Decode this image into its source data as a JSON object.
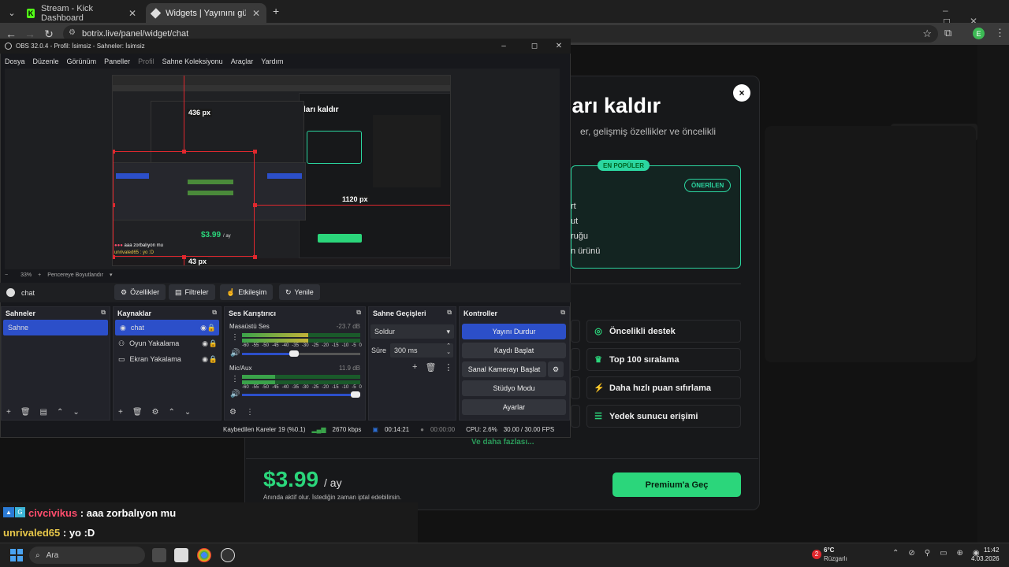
{
  "browser": {
    "tabs": [
      {
        "title": "Stream - Kick Dashboard",
        "active": false,
        "icon": "kick-logo"
      },
      {
        "title": "Widgets | Yayınını güçlendirmek",
        "active": true,
        "icon": "botrix-logo"
      }
    ],
    "new_tab": "+",
    "url": "botrix.live/panel/widget/chat",
    "profile_initial": "E"
  },
  "modal": {
    "title_fragment": "ları kaldır",
    "subtitle_fragment": "er, gelişmiş özellikler ve öncelikli",
    "badge_popular": "EN POPÜLER",
    "badge_recommended": "ÖNERİLEN",
    "plan_fragments": [
      "rt",
      "ut",
      "ruğu",
      "n ürünü"
    ],
    "features": [
      {
        "label": "Öncelikli destek",
        "icon": "headset-icon"
      },
      {
        "label": "Top 100 sıralama",
        "icon": "trophy-icon"
      },
      {
        "label": "Daha hızlı puan sıfırlama",
        "icon": "lightning-icon"
      },
      {
        "label": "Yedek sunucu erişimi",
        "icon": "server-icon"
      }
    ],
    "more": "Ve daha fazlası...",
    "price": "$3.99",
    "per": "/ ay",
    "note": "Anında aktif olur. İstediğin zaman iptal edebilirsin.",
    "cta": "Premium'a Geç",
    "close": "×"
  },
  "chat_overlay": [
    {
      "user": "civcivikus",
      "message": " : aaa zorbalıyon mu",
      "color": "#ff4d6d"
    },
    {
      "user": "unrivaled65",
      "message": " : yo :D",
      "color": "#e8c84a"
    }
  ],
  "obs": {
    "title": "OBS 32.0.4 - Profil: İsimsiz - Sahneler: İsimsiz",
    "menu": [
      "Dosya",
      "Düzenle",
      "Görünüm",
      "Paneller",
      "Profil",
      "Sahne Koleksiyonu",
      "Araçlar",
      "Yardım"
    ],
    "preview_labels": {
      "width_label": "436 px",
      "right_label": "1120 px",
      "bottom_label": "43 px",
      "mini_title": "ları kaldır",
      "mini_price": "$3.99",
      "mini_per": "/ ay",
      "mini_chat1": "aaa zorbalıyon mu",
      "mini_chat2": "unrivaled65 : yo :D"
    },
    "zoom": {
      "minus": "−",
      "level": "33%",
      "plus": "+",
      "fit": "Pencereye Boyutlandır"
    },
    "source_name": "chat",
    "source_buttons": [
      "Özellikler",
      "Filtreler",
      "Etkileşim",
      "Yenile"
    ],
    "scenes": {
      "title": "Sahneler",
      "items": [
        "Sahne"
      ]
    },
    "sources": {
      "title": "Kaynaklar",
      "items": [
        "chat",
        "Oyun Yakalama",
        "Ekran Yakalama"
      ]
    },
    "mixer": {
      "title": "Ses Karıştırıcı",
      "channels": [
        {
          "name": "Masaüstü Ses",
          "db": "-23.7 dB",
          "level": 0.56
        },
        {
          "name": "Mic/Aux",
          "db": "11.9 dB",
          "level": 0.28
        }
      ],
      "scale": [
        "-60",
        "-55",
        "-50",
        "-45",
        "-40",
        "-35",
        "-30",
        "-25",
        "-20",
        "-15",
        "-10",
        "-5",
        "0"
      ]
    },
    "transitions": {
      "title": "Sahne Geçişleri",
      "type": "Soldur",
      "duration_label": "Süre",
      "duration": "300 ms"
    },
    "controls": {
      "title": "Kontroller",
      "buttons": [
        "Yayını Durdur",
        "Kaydı Başlat",
        "Sanal Kamerayı Başlat",
        "Stüdyo Modu",
        "Ayarlar"
      ]
    },
    "status": {
      "dropped": "Kaybedilen Kareler 19 (%0.1)",
      "bitrate": "2670 kbps",
      "stream_time": "00:14:21",
      "rec_time": "00:00:00",
      "cpu": "CPU: 2.6%",
      "fps": "30.00 / 30.00 FPS"
    }
  },
  "taskbar": {
    "search": "Ara",
    "weather_temp": "6°C",
    "weather_desc": "Rüzgarlı",
    "notif_badge": "2",
    "time": "11:42",
    "date": "4.03.2026"
  },
  "colors": {
    "accent_green": "#2bd67b",
    "teal": "#2bd6a0",
    "obs_blue": "#2c4fc9",
    "red_guides": "#e0282e"
  }
}
